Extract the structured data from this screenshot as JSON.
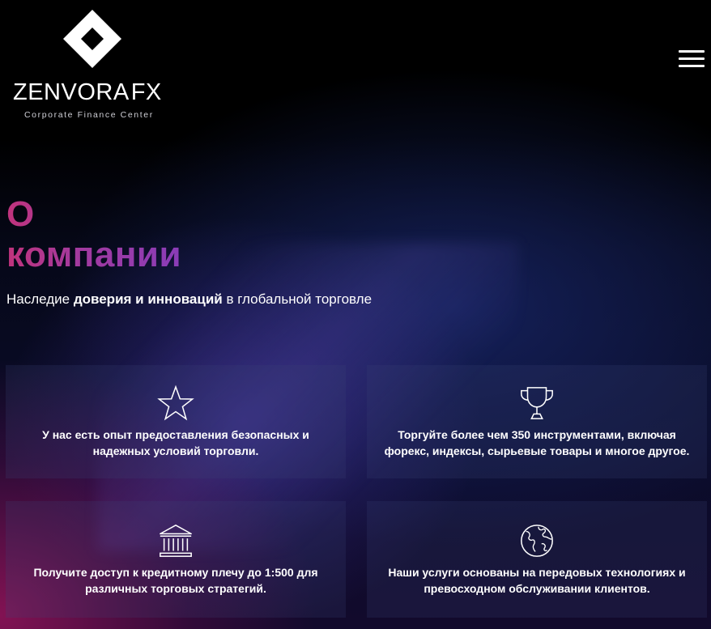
{
  "logo": {
    "name": "ZENVORA",
    "suffix": "FX",
    "tagline": "Corporate Finance Center"
  },
  "heading": {
    "line1": "О",
    "line2": "компании"
  },
  "subtitle": {
    "part1": "Наследие ",
    "bold": "доверия и инноваций",
    "part2": " в глобальной торговле"
  },
  "cards": [
    {
      "icon": "star-icon",
      "text": "У нас есть опыт предоставления безопасных и надежных условий торговли."
    },
    {
      "icon": "trophy-icon",
      "text": "Торгуйте более чем 350 инструментами, включая форекс, индексы, сырьевые товары и многое другое."
    },
    {
      "icon": "bank-icon",
      "text": "Получите доступ к кредитному плечу до 1:500 для различных торговых стратегий."
    },
    {
      "icon": "globe-icon",
      "text": "Наши услуги основаны на передовых технологиях и превосходном обслуживании клиентов."
    }
  ],
  "colors": {
    "heading_gradient_start": "#c0337c",
    "heading_gradient_end": "#8a3cb8",
    "background": "#000000"
  }
}
